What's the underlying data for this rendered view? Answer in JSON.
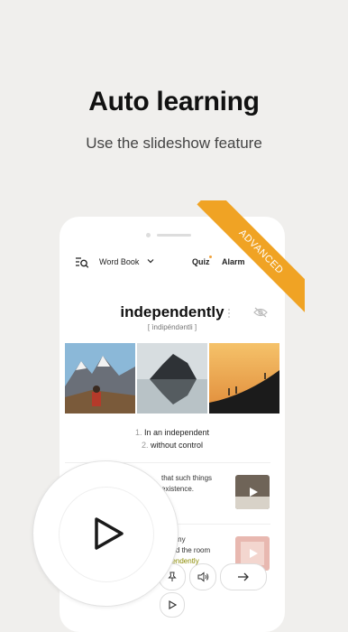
{
  "promo": {
    "headline": "Auto learning",
    "subhead": "Use the slideshow feature",
    "ribbon": "ADVANCED"
  },
  "topbar": {
    "wordbook_label": "Word Book",
    "quiz_label": "Quiz",
    "alarm_label": "Alarm"
  },
  "card": {
    "word": "independently",
    "pronunciation": "[ ìndipéndəntli ]",
    "definitions": [
      {
        "num": "1.",
        "text": "In an independent"
      },
      {
        "num": "2.",
        "text": "without control"
      }
    ],
    "example1_line1": "that such things",
    "example1_line2": "existence.",
    "example2_line1": "many",
    "example2_line2": "had the room",
    "example2_highlight": "pendently"
  },
  "colors": {
    "accent": "#f0a324",
    "background": "#f0efed"
  },
  "icons": [
    "menu-search-icon",
    "chevron-down-icon",
    "more-icon",
    "eye-off-icon",
    "play-icon",
    "pin-icon",
    "speaker-icon",
    "arrow-right-icon"
  ]
}
